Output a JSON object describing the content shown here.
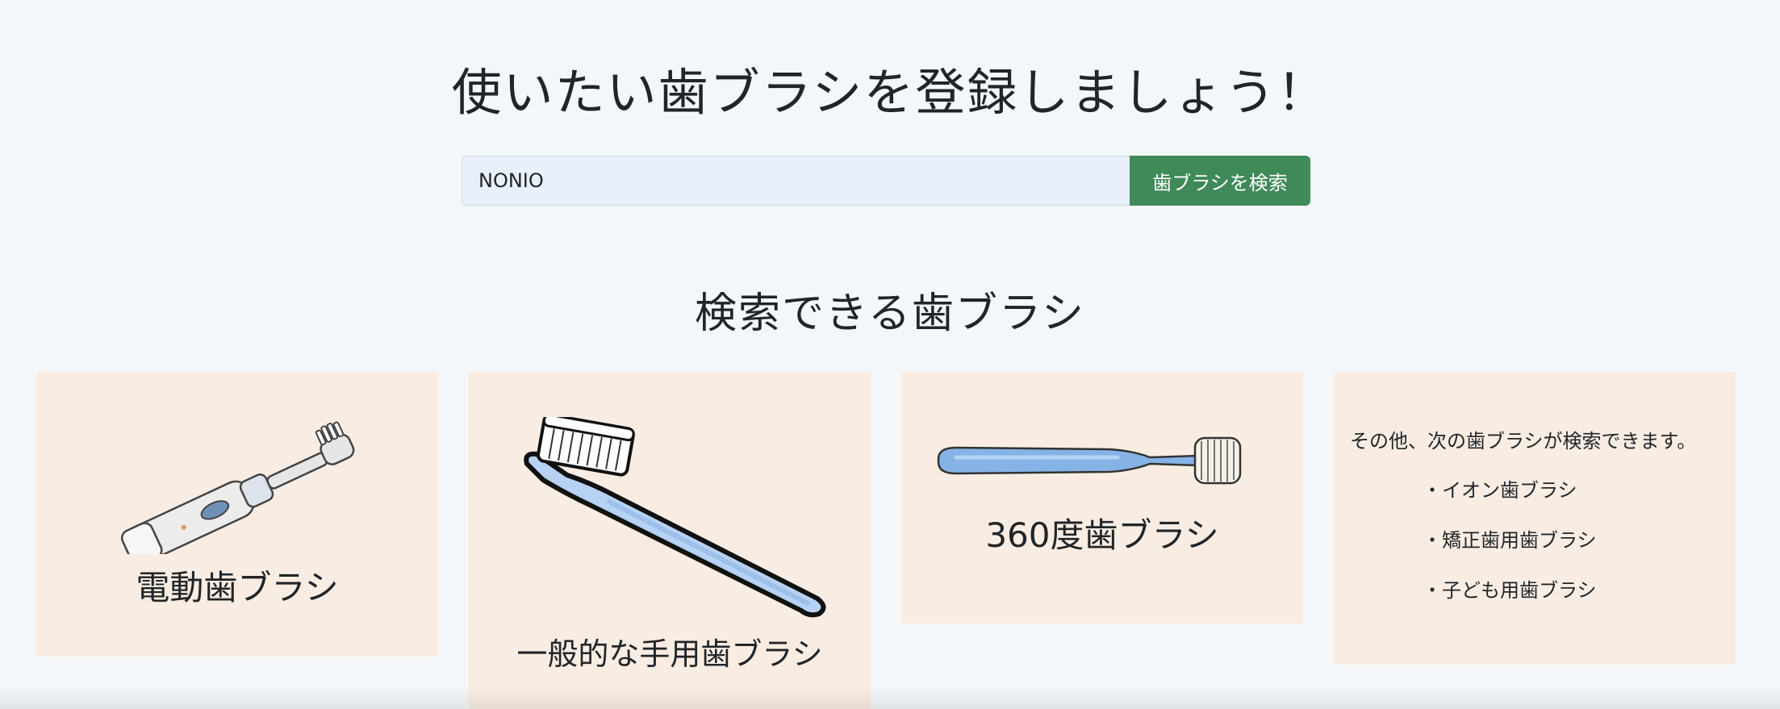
{
  "header": {
    "title": "使いたい歯ブラシを登録しましょう！"
  },
  "search": {
    "value": "NONIO",
    "button_label": "歯ブラシを検索"
  },
  "section": {
    "title": "検索できる歯ブラシ"
  },
  "cards": {
    "electric": {
      "label": "電動歯ブラシ",
      "icon": "electric-toothbrush-icon"
    },
    "manual": {
      "label": "一般的な手用歯ブラシ",
      "icon": "manual-toothbrush-icon"
    },
    "three_sixty": {
      "label": "360度歯ブラシ",
      "icon": "360-toothbrush-icon"
    },
    "other": {
      "intro": "その他、次の歯ブラシが検索できます。",
      "items": [
        "・イオン歯ブラシ",
        "・矯正歯用歯ブラシ",
        "・子ども用歯ブラシ"
      ]
    }
  },
  "colors": {
    "background": "#f4f7f9",
    "card_background": "#f9ede3",
    "button_green": "#3f8a58",
    "input_background": "#e9f0fd",
    "brush_blue": "#8fb8e8"
  }
}
